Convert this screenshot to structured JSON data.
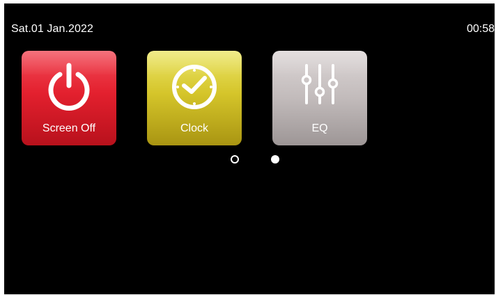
{
  "status_bar": {
    "date": "Sat.01 Jan.2022",
    "time": "00:58"
  },
  "apps": [
    {
      "label": "Screen Off",
      "icon": "power-icon",
      "color": "#e3202e"
    },
    {
      "label": "Clock",
      "icon": "clock-icon",
      "color": "#d5c52a"
    },
    {
      "label": "EQ",
      "icon": "equalizer-icon",
      "color": "#c2bbbb"
    }
  ],
  "pager": {
    "pages": 2,
    "current_page": 2
  }
}
